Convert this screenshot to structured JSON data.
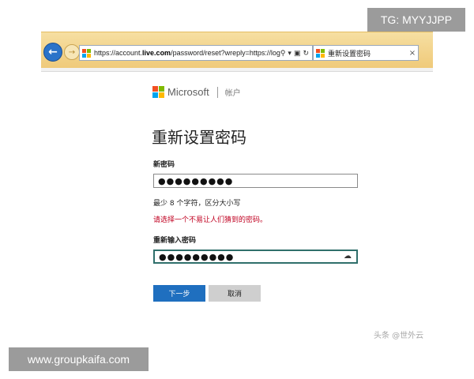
{
  "watermarks": {
    "top": "TG: MYYJJPP",
    "bottom": "www.groupkaifa.com"
  },
  "browser": {
    "address_prefix": "https://account.",
    "address_domain": "live.com",
    "address_rest": "/password/reset?wreply=https://log",
    "address_icons": [
      "search-icon",
      "dropdown-icon",
      "lock-icon",
      "refresh-icon"
    ],
    "tab_title": "重新设置密码",
    "tab_close": "×"
  },
  "brand": {
    "name": "Microsoft",
    "section": "帐户",
    "colors": [
      "#f25022",
      "#7fba00",
      "#00a4ef",
      "#ffb900"
    ]
  },
  "form": {
    "title": "重新设置密码",
    "new_password_label": "新密码",
    "new_password_value": "●●●●●●●●●",
    "requirement": "最少 8 个字符，区分大小写",
    "warning": "请选择一个不易让人们猜到的密码。",
    "confirm_password_label": "重新输入密码",
    "confirm_password_value": "●●●●●●●●●",
    "next_button": "下一步",
    "cancel_button": "取消"
  },
  "credit": "头条 @世外云",
  "colors": {
    "primary": "#1f6fbf",
    "warning": "#c00020",
    "focus": "#2f6f6b"
  }
}
